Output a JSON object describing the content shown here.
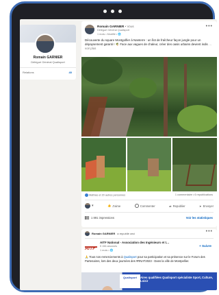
{
  "profile": {
    "name": "Romain GARNIER",
    "title": "Délégué Général Qualisport",
    "stat_label": "Relations",
    "stat_value": "40"
  },
  "post": {
    "author": "Romain GARNIER",
    "author_meta": "• Vous",
    "author_title": "Délégué Général Qualisport",
    "time": "1 mois • Modifié • 🌐",
    "text": "Découverte du square Montgolfier à Nanterre : un îlot de fraîcheur façon jungle pour un dépaysement garanti ! 🌴 Face aux vagues de chaleur, créer des oasis urbains devient indis",
    "see_more": "…voir plus",
    "reactions": "Mathias et 20 autres personnes",
    "counts": "1 commentaire • 6 republications",
    "actions": {
      "like": "J'aime",
      "comment": "Commenter",
      "repost": "Republier",
      "send": "Envoyer"
    },
    "impressions": "1 891 impressions",
    "stats_link": "Voir les statistiques"
  },
  "post2": {
    "reposter": "Romain GARNIER",
    "repost_label": "a republié ceci",
    "org": "AITF National - Association des Ingénieurs et t…",
    "followers": "5 156 abonnés",
    "time": "1 mois • 🌐",
    "follow": "+ Suivre",
    "text_before": "🙏 Tous nos remerciements à",
    "mention": "Qualisport",
    "text_after": "pour sa participation et sa présence sur le Forum des Partenaires, lors des deux journées des #RNAT2023 - Dans la ville de Montpellier.",
    "banner_logo": "Qualisport",
    "banner_text": "Aires qualifiées Qualisport spécialiste Sport, Culture, Loisir"
  }
}
